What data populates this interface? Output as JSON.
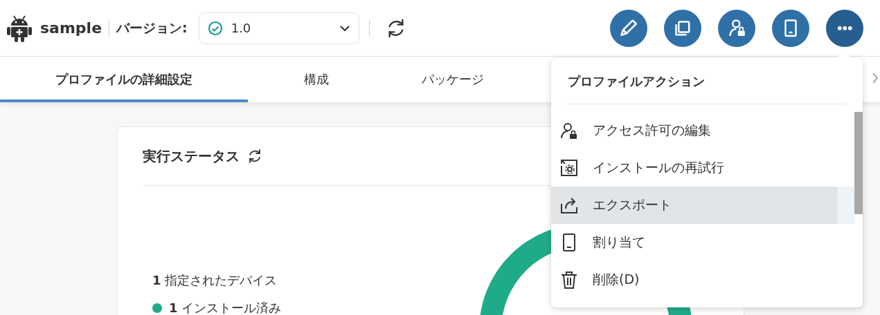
{
  "header": {
    "app_name": "sample",
    "version_label": "バージョン:",
    "version_select": {
      "value": "1.0"
    }
  },
  "tabs": [
    {
      "label": "プロファイルの詳細設定",
      "selected": true
    },
    {
      "label": "構成",
      "selected": false
    },
    {
      "label": "パッケージ",
      "selected": false
    }
  ],
  "card": {
    "title": "実行ステータス",
    "summary": {
      "count": "1",
      "label": "指定されたデバイス"
    },
    "legend": [
      {
        "count": "1",
        "label": "インストール済み",
        "color": "#1fab89"
      }
    ]
  },
  "menu": {
    "title": "プロファイルアクション",
    "items": [
      {
        "kind": "permissions",
        "label": "アクセス許可の編集",
        "highlighted": false
      },
      {
        "kind": "retry",
        "label": "インストールの再試行",
        "highlighted": false
      },
      {
        "kind": "export",
        "label": "エクスポート",
        "highlighted": true
      },
      {
        "kind": "assign",
        "label": "割り当て",
        "highlighted": false
      },
      {
        "kind": "delete",
        "label": "削除(D)",
        "highlighted": false
      }
    ]
  }
}
